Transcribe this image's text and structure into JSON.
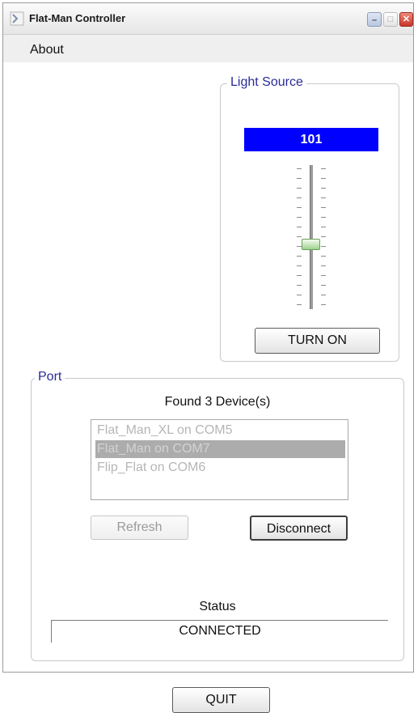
{
  "window": {
    "title": "Flat-Man Controller"
  },
  "titlebar": {
    "minimize_glyph": "–",
    "maximize_glyph": "□",
    "close_glyph": "✕"
  },
  "menu": {
    "items": [
      {
        "label": "About"
      }
    ]
  },
  "light_source": {
    "title": "Light Source",
    "level_value": "101",
    "slider_level_fraction": 0.45,
    "button_label": "TURN ON",
    "accent_color": "#0000ff"
  },
  "port": {
    "title": "Port",
    "found_label": "Found 3 Device(s)",
    "devices": [
      {
        "label": "Flat_Man_XL on COM5"
      },
      {
        "label": "Flat_Man on COM7"
      },
      {
        "label": "Flip_Flat on COM6"
      }
    ],
    "refresh_label": "Refresh",
    "disconnect_label": "Disconnect",
    "status_label": "Status",
    "status_value": "CONNECTED",
    "quit_label": "QUIT"
  },
  "icons": {
    "app": "app-icon",
    "minimize": "minimize-icon",
    "maximize": "maximize-icon",
    "close": "close-icon"
  }
}
